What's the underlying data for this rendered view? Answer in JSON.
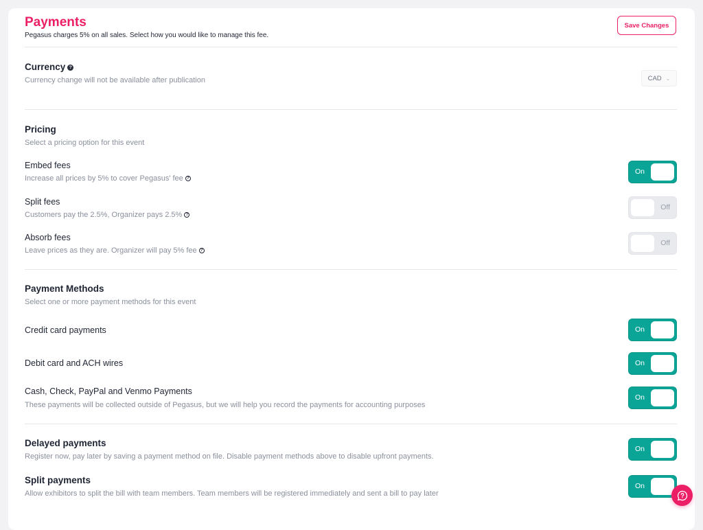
{
  "header": {
    "title": "Payments",
    "subtitle": "Pegasus charges 5% on all sales. Select how you would like to manage this fee.",
    "save_label": "Save Changes"
  },
  "currency": {
    "title": "Currency",
    "help": "?",
    "desc": "Currency change will not be available after publication",
    "selected": "CAD"
  },
  "pricing": {
    "title": "Pricing",
    "desc": "Select a pricing option for this event",
    "options": [
      {
        "label": "Embed fees",
        "desc": "Increase all prices by 5% to cover Pegasus' fee",
        "state": "On"
      },
      {
        "label": "Split fees",
        "desc": "Customers pay the 2.5%, Organizer pays 2.5%",
        "state": "Off"
      },
      {
        "label": "Absorb fees",
        "desc": "Leave prices as they are. Organizer will pay 5% fee",
        "state": "Off"
      }
    ]
  },
  "methods": {
    "title": "Payment Methods",
    "desc": "Select one or more payment methods for this event",
    "items": [
      {
        "label": "Credit card payments",
        "state": "On"
      },
      {
        "label": "Debit card and ACH wires",
        "state": "On"
      },
      {
        "label": "Cash, Check, PayPal and Venmo Payments",
        "desc": "These payments will be collected outside of Pegasus, but we will help you record the payments for accounting purposes",
        "state": "On"
      }
    ]
  },
  "delayed": {
    "title": "Delayed payments",
    "desc": "Register now, pay later by saving a payment method on file. Disable payment methods above to disable upfront payments.",
    "state": "On"
  },
  "split": {
    "title": "Split payments",
    "desc": "Allow exhibitors to split the bill with team members. Team members will be registered immediately and sent a bill to pay later",
    "state": "On"
  },
  "colors": {
    "accent": "#ec1f66",
    "toggle_on": "#0ba598",
    "toggle_off": "#e9eaee"
  },
  "icons": {
    "help": "question-circle-icon",
    "chat": "chat-help-icon",
    "select": "chevron-down-icon"
  }
}
